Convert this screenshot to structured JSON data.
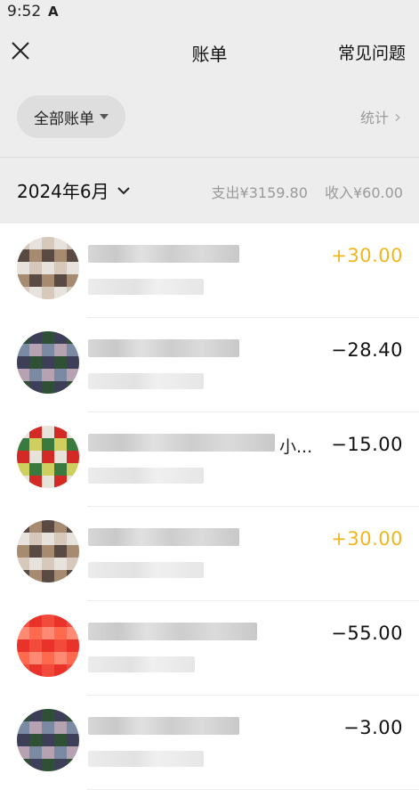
{
  "status_bar": {
    "time": "9:52",
    "icon": "A"
  },
  "nav": {
    "title": "账单",
    "faq": "常见问题",
    "close_icon": "close-icon"
  },
  "filter": {
    "label": "全部账单",
    "stats": "统计"
  },
  "month": {
    "label": "2024年6月",
    "expense": "支出¥3159.80",
    "income": "收入¥60.00"
  },
  "transactions": [
    {
      "amount": "+30.00",
      "type": "income",
      "suffix": "",
      "avatar_colors": [
        "#d6c8bb",
        "#a68b70",
        "#e8e2dc",
        "#5a4a44"
      ]
    },
    {
      "amount": "−28.40",
      "type": "expense",
      "suffix": "",
      "avatar_colors": [
        "#7a8aa3",
        "#2f5034",
        "#b7a2b1",
        "#3c3f57"
      ]
    },
    {
      "amount": "−15.00",
      "type": "expense",
      "suffix": "小...",
      "avatar_colors": [
        "#d42a25",
        "#3a7a3e",
        "#e8e3d8",
        "#cfcf60"
      ]
    },
    {
      "amount": "+30.00",
      "type": "income",
      "suffix": "",
      "avatar_colors": [
        "#d6c8bb",
        "#a68b70",
        "#e8e2dc",
        "#5a4a44"
      ]
    },
    {
      "amount": "−55.00",
      "type": "expense",
      "suffix": "",
      "avatar_colors": [
        "#f24a3b",
        "#ff6a4f",
        "#e8322a",
        "#ff8a73"
      ]
    },
    {
      "amount": "−3.00",
      "type": "expense",
      "suffix": "",
      "avatar_colors": [
        "#7a8aa3",
        "#2f5034",
        "#b7a2b1",
        "#3c3f57"
      ]
    }
  ],
  "colors": {
    "income": "#f2b61d",
    "background": "#ededed"
  }
}
